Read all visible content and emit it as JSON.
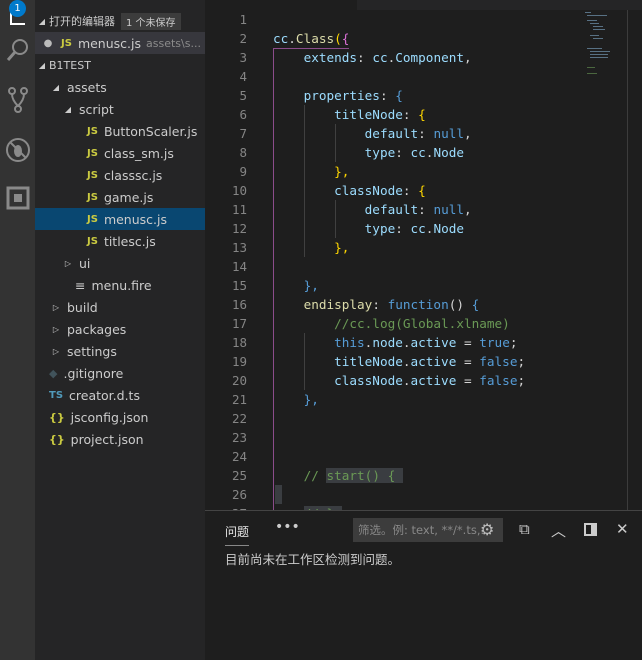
{
  "activity": {
    "badge": "1",
    "items": [
      "explorer-icon",
      "search-icon",
      "source-control-icon",
      "debug-icon",
      "extensions-icon"
    ]
  },
  "explorer": {
    "open_editors": {
      "title": "打开的编辑器",
      "unsaved": "1 个未保存",
      "items": [
        {
          "name": "menusc.js",
          "desc": "assets\\s...",
          "icon": "JS",
          "dirty": true
        }
      ]
    },
    "project": {
      "title": "B1TEST"
    },
    "tree": [
      {
        "label": "assets",
        "type": "folder",
        "open": true,
        "depth": 0
      },
      {
        "label": "script",
        "type": "folder",
        "open": true,
        "depth": 1
      },
      {
        "label": "ButtonScaler.js",
        "type": "js",
        "depth": 2
      },
      {
        "label": "class_sm.js",
        "type": "js",
        "depth": 2
      },
      {
        "label": "classsc.js",
        "type": "js",
        "depth": 2
      },
      {
        "label": "game.js",
        "type": "js",
        "depth": 2
      },
      {
        "label": "menusc.js",
        "type": "js",
        "depth": 2,
        "selected": true
      },
      {
        "label": "titlesc.js",
        "type": "js",
        "depth": 2
      },
      {
        "label": "ui",
        "type": "folder",
        "open": false,
        "depth": 1
      },
      {
        "label": "menu.fire",
        "type": "file",
        "depth": 1
      },
      {
        "label": "build",
        "type": "folder",
        "open": false,
        "depth": 0
      },
      {
        "label": "packages",
        "type": "folder",
        "open": false,
        "depth": 0
      },
      {
        "label": "settings",
        "type": "folder",
        "open": false,
        "depth": 0
      },
      {
        "label": ".gitignore",
        "type": "git",
        "depth": 0
      },
      {
        "label": "creator.d.ts",
        "type": "ts",
        "depth": 0
      },
      {
        "label": "jsconfig.json",
        "type": "json",
        "depth": 0
      },
      {
        "label": "project.json",
        "type": "json",
        "depth": 0
      }
    ]
  },
  "editor": {
    "lines": [
      [],
      [
        [
          "cc",
          "p"
        ],
        [
          ".",
          ""
        ],
        [
          "Class",
          "f"
        ],
        [
          "(",
          "y"
        ],
        [
          "{",
          "m"
        ]
      ],
      [
        [
          "    "
        ],
        [
          "extends",
          "p"
        ],
        [
          ": "
        ],
        [
          "cc",
          "p"
        ],
        [
          "."
        ],
        [
          "Component",
          "p"
        ],
        [
          ","
        ]
      ],
      [],
      [
        [
          "    "
        ],
        [
          "properties",
          "p"
        ],
        [
          ": "
        ],
        [
          "{",
          "k"
        ]
      ],
      [
        [
          "        "
        ],
        [
          "titleNode",
          "p"
        ],
        [
          ": "
        ],
        [
          "{",
          "y"
        ]
      ],
      [
        [
          "            "
        ],
        [
          "default",
          "p"
        ],
        [
          ": "
        ],
        [
          "null",
          "k"
        ],
        [
          ","
        ]
      ],
      [
        [
          "            "
        ],
        [
          "type",
          "p"
        ],
        [
          ": "
        ],
        [
          "cc",
          "p"
        ],
        [
          "."
        ],
        [
          "Node",
          "p"
        ]
      ],
      [
        [
          "        "
        ],
        [
          "},",
          "y"
        ]
      ],
      [
        [
          "        "
        ],
        [
          "classNode",
          "p"
        ],
        [
          ": "
        ],
        [
          "{",
          "y"
        ]
      ],
      [
        [
          "            "
        ],
        [
          "default",
          "p"
        ],
        [
          ": "
        ],
        [
          "null",
          "k"
        ],
        [
          ","
        ]
      ],
      [
        [
          "            "
        ],
        [
          "type",
          "p"
        ],
        [
          ": "
        ],
        [
          "cc",
          "p"
        ],
        [
          "."
        ],
        [
          "Node",
          "p"
        ]
      ],
      [
        [
          "        "
        ],
        [
          "},",
          "y"
        ]
      ],
      [],
      [
        [
          "    "
        ],
        [
          "},",
          "k"
        ]
      ],
      [
        [
          "    "
        ],
        [
          "endisplay",
          "f"
        ],
        [
          ": "
        ],
        [
          "function",
          "k"
        ],
        [
          "() ",
          ""
        ],
        [
          "{",
          "k"
        ]
      ],
      [
        [
          "        "
        ],
        [
          "//cc.log(Global.xlname)",
          "c"
        ]
      ],
      [
        [
          "        "
        ],
        [
          "this",
          "k"
        ],
        [
          "."
        ],
        [
          "node",
          "p"
        ],
        [
          "."
        ],
        [
          "active",
          "p"
        ],
        [
          " = "
        ],
        [
          "true",
          "k"
        ],
        [
          ";"
        ]
      ],
      [
        [
          "        "
        ],
        [
          "titleNode",
          "p"
        ],
        [
          "."
        ],
        [
          "active",
          "p"
        ],
        [
          " = "
        ],
        [
          "false",
          "k"
        ],
        [
          ";"
        ]
      ],
      [
        [
          "        "
        ],
        [
          "classNode",
          "p"
        ],
        [
          "."
        ],
        [
          "active",
          "p"
        ],
        [
          " = "
        ],
        [
          "false",
          "k"
        ],
        [
          ";"
        ]
      ],
      [
        [
          "    "
        ],
        [
          "},",
          "k"
        ]
      ],
      [],
      [],
      [],
      [
        [
          "    "
        ],
        [
          "// ",
          "c"
        ],
        [
          "start() { ",
          "c hl"
        ]
      ],
      [],
      [
        [
          "    "
        ],
        [
          "// },",
          "c hl"
        ]
      ]
    ]
  },
  "panel": {
    "tab": "问题",
    "more": "•••",
    "filter_placeholder": "筛选。例: text, **/*.ts,...",
    "message": "目前尚未在工作区检测到问题。"
  }
}
